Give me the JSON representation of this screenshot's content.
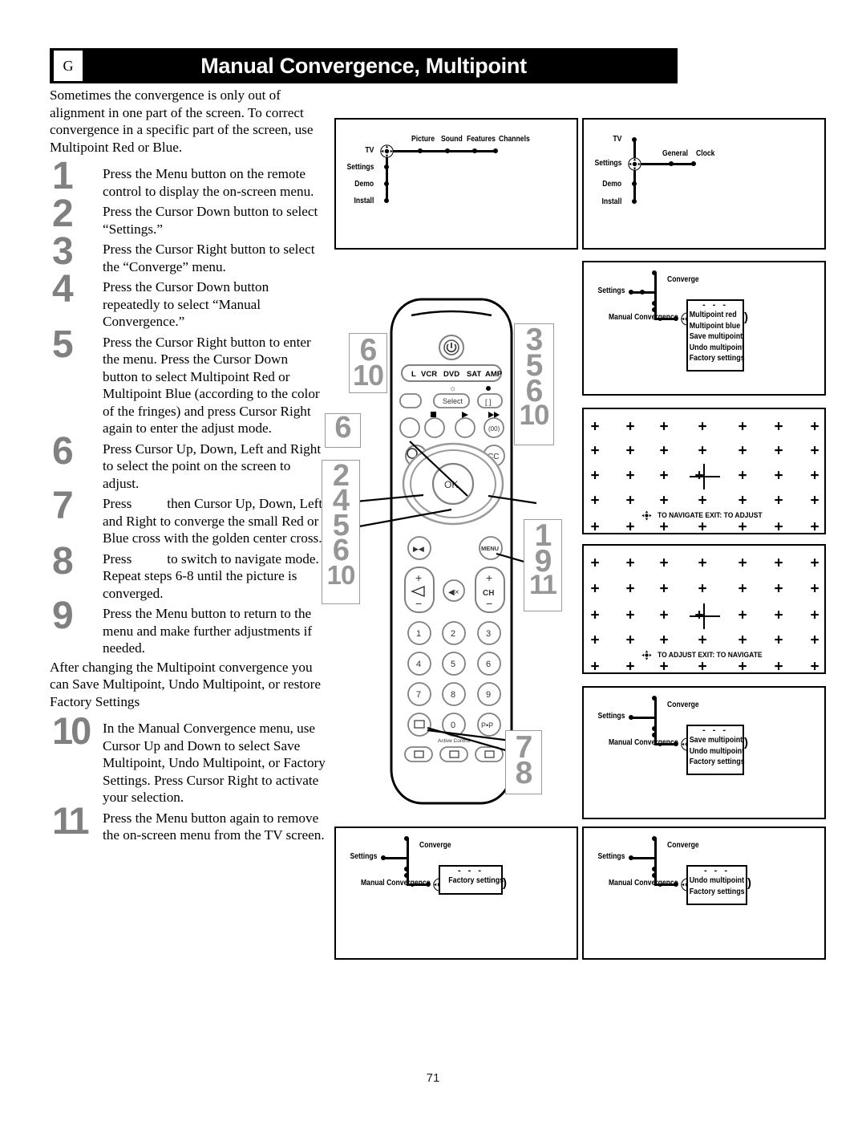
{
  "header": {
    "tab": "G",
    "title": "Manual Convergence, Multipoint"
  },
  "intro": "Sometimes the convergence is only out of alignment in one part of the screen.  To correct convergence in a specific part of the screen, use Multipoint Red or Blue.",
  "steps": [
    {
      "num": "1",
      "text": "Press the Menu button on the remote control to display the on-screen menu."
    },
    {
      "num": "2",
      "text": "Press the Cursor Down button to select “Settings.”"
    },
    {
      "num": "3",
      "text": "Press the Cursor Right button to select the “Converge” menu."
    },
    {
      "num": "4",
      "text": "Press the Cursor Down button repeatedly to select “Manual Convergence.”"
    },
    {
      "num": "5",
      "text": "Press the Cursor Right button to enter the menu.  Press the Cursor Down button to select Multipoint Red or Multipoint Blue (according to the color of the fringes) and press Cursor Right again to enter the adjust mode."
    },
    {
      "num": "6",
      "text": "Press Cursor Up, Down, Left and Right to select the point on the screen to adjust."
    },
    {
      "num": "7",
      "text_before": "Press",
      "text_after": "then Cursor Up, Down, Left and Right to converge the small Red or Blue cross with the golden center cross."
    },
    {
      "num": "8",
      "text_before": "Press",
      "text_after": "to switch to navigate mode.  Repeat steps 6-8 until the picture is converged."
    },
    {
      "num": "9",
      "text": "Press the Menu button to return to the menu and make further adjustments if needed."
    }
  ],
  "mid_para": "After changing the Multipoint convergence you can Save Multipoint, Undo Multipoint, or restore Factory Settings",
  "steps2": [
    {
      "num": "10",
      "text": "In the Manual Convergence menu, use Cursor Up and Down to select Save Multipoint, Undo Multipoint, or Factory Settings.  Press Cursor Right to activate your selection."
    },
    {
      "num": "11",
      "text": "Press the Menu button again to remove the on-screen menu from the TV screen."
    }
  ],
  "diagrams": {
    "tv_menu": {
      "vertical_items": [
        "TV",
        "Settings",
        "Demo",
        "Install"
      ],
      "horizontal_items": [
        "Picture",
        "Sound",
        "Features",
        "Channels"
      ],
      "selected": "TV"
    },
    "settings_menu": {
      "vertical_items": [
        "TV",
        "Settings",
        "Demo",
        "Install"
      ],
      "horizontal_items": [
        "General",
        "Clock"
      ],
      "selected": "Settings"
    },
    "converge_full": {
      "branch_label": "Converge",
      "parent_label": "Settings",
      "node_label": "Manual Convergence",
      "dots": "- - -",
      "items": [
        "Multipoint red",
        "Multipoint blue",
        "Save multipoint",
        "Undo multipoint",
        "Factory settings"
      ],
      "selected": "Multipoint red"
    },
    "converge_save": {
      "branch_label": "Converge",
      "parent_label": "Settings",
      "node_label": "Manual Convergence",
      "dots": "- - -",
      "items": [
        "Save multipoint",
        "Undo multipoint",
        "Factory settings"
      ],
      "selected": "Save multipoint"
    },
    "converge_factory": {
      "branch_label": "Converge",
      "parent_label": "Settings",
      "node_label": "Manual Convergence",
      "dots": "- - -",
      "items": [
        "Factory settings"
      ],
      "selected": "Factory settings"
    },
    "converge_undo": {
      "branch_label": "Converge",
      "parent_label": "Settings",
      "node_label": "Manual Convergence",
      "dots": "- - -",
      "items": [
        "Undo multipoint",
        "Factory settings"
      ],
      "selected": "Undo multipoint"
    },
    "grid_navigate": {
      "columns": 7,
      "rows": 5,
      "cursor_row": 3,
      "cursor_col": 4,
      "hint": "TO NAVIGATE EXIT: TO ADJUST"
    },
    "grid_adjust": {
      "columns": 7,
      "rows": 5,
      "cursor_row": 3,
      "cursor_col": 4,
      "hint": "TO ADJUST EXIT: TO NAVIGATE"
    }
  },
  "remote": {
    "mode_labels": [
      "L",
      "VCR",
      "DVD",
      "SAT",
      "AMP"
    ],
    "select_label": "Select",
    "cc_label": "CC",
    "ok_label": "OK",
    "menu_label": "MENU",
    "ch_label": "CH",
    "active_label": "Active Control",
    "keypad": [
      "1",
      "2",
      "3",
      "4",
      "5",
      "6",
      "7",
      "8",
      "9",
      "0"
    ],
    "pip_label": "P•P",
    "callouts": [
      {
        "id": "callout-6-10",
        "values": [
          "6",
          "10"
        ]
      },
      {
        "id": "callout-6",
        "values": [
          "6"
        ]
      },
      {
        "id": "callout-2-4-5-6-10",
        "values": [
          "2",
          "4",
          "5",
          "6",
          "10"
        ]
      },
      {
        "id": "callout-3-5-6-10",
        "values": [
          "3",
          "5",
          "6",
          "10"
        ]
      },
      {
        "id": "callout-1-9-11",
        "values": [
          "1",
          "9",
          "11"
        ]
      },
      {
        "id": "callout-7-8",
        "values": [
          "7",
          "8"
        ]
      }
    ]
  },
  "footer": {
    "page_number": "71"
  },
  "colors": {
    "step_number": "#808080",
    "header_band": "#000000",
    "callout_text": "#969696"
  }
}
